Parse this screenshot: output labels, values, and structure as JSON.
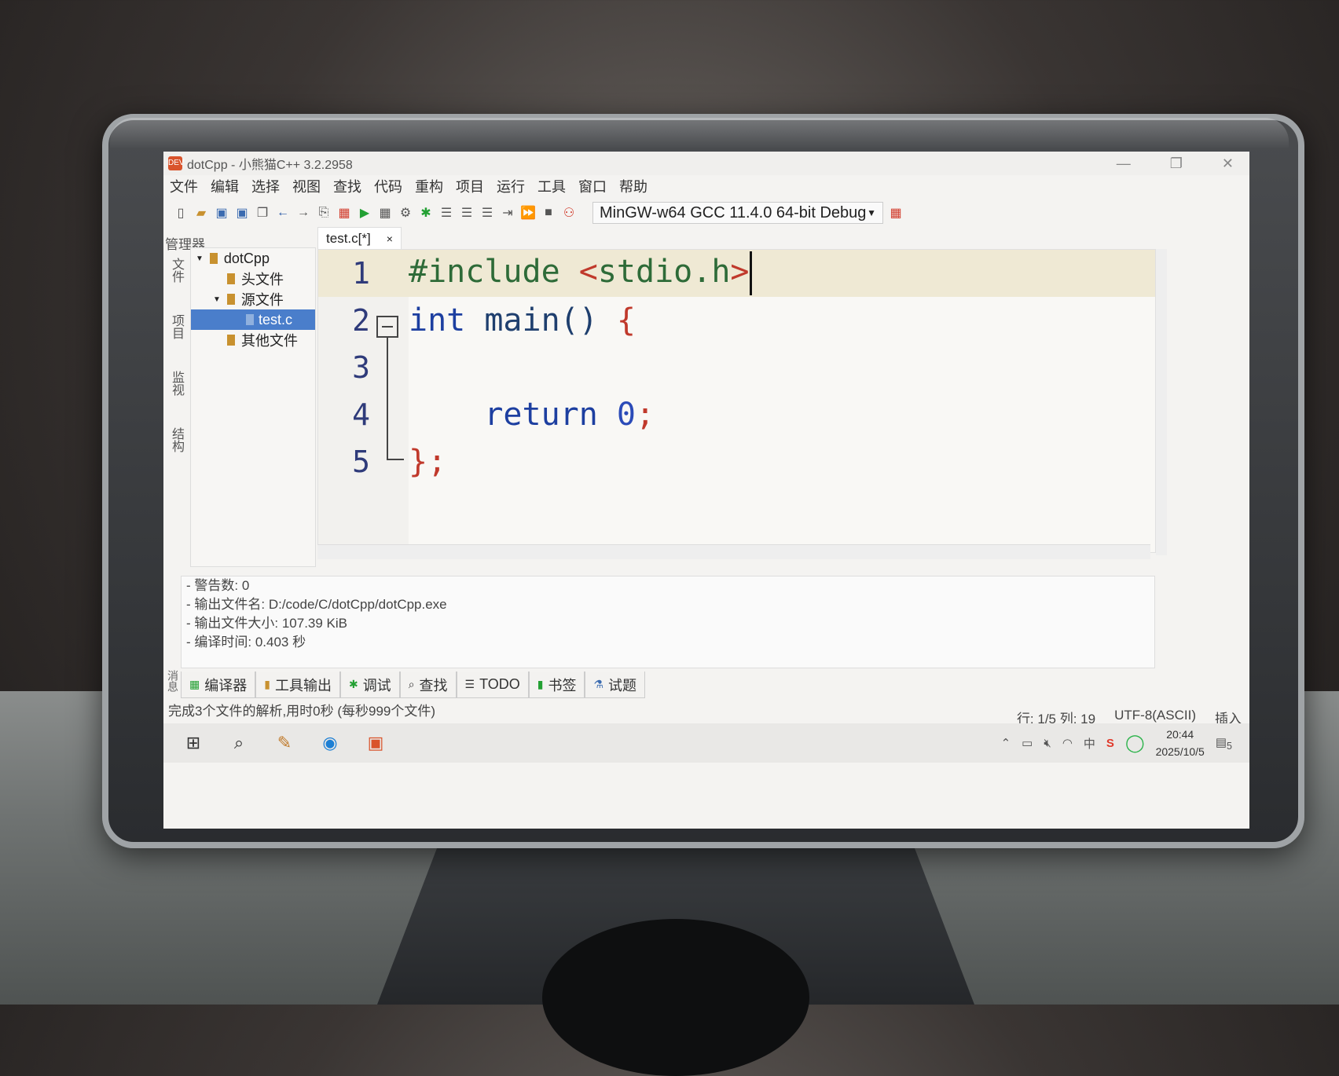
{
  "window": {
    "title": "dotCpp - 小熊猫C++ 3.2.2958",
    "app_icon_text": "DEV",
    "controls": [
      "—",
      "❐",
      "✕"
    ]
  },
  "menu": [
    "文件",
    "编辑",
    "选择",
    "视图",
    "查找",
    "代码",
    "重构",
    "项目",
    "运行",
    "工具",
    "窗口",
    "帮助"
  ],
  "toolbar": {
    "compiler": "MinGW-w64 GCC 11.4.0 64-bit Debug"
  },
  "left_panel": {
    "title": "管理器",
    "side_tabs": [
      "文件",
      "项目",
      "监视",
      "结构"
    ],
    "tree": [
      {
        "label": "dotCpp",
        "level": 0,
        "type": "folder",
        "expanded": true
      },
      {
        "label": "头文件",
        "level": 1,
        "type": "folder"
      },
      {
        "label": "源文件",
        "level": 1,
        "type": "folder",
        "expanded": true
      },
      {
        "label": "test.c",
        "level": 2,
        "type": "file",
        "selected": true
      },
      {
        "label": "其他文件",
        "level": 1,
        "type": "folder"
      }
    ]
  },
  "editor": {
    "tab_label": "test.c[*]",
    "tab_close": "×",
    "lines": [
      {
        "n": "1",
        "parts": [
          [
            "pp",
            "#include "
          ],
          [
            "br",
            "<"
          ],
          [
            "pp",
            "stdio.h"
          ],
          [
            "br",
            ">"
          ]
        ]
      },
      {
        "n": "2",
        "parts": [
          [
            "kw",
            "int"
          ],
          [
            "fn",
            " main() "
          ],
          [
            "br",
            "{"
          ]
        ]
      },
      {
        "n": "3",
        "parts": []
      },
      {
        "n": "4",
        "parts": [
          [
            "fn",
            "    "
          ],
          [
            "kw",
            "return "
          ],
          [
            "num",
            "0"
          ],
          [
            "br",
            ";"
          ]
        ]
      },
      {
        "n": "5",
        "parts": [
          [
            "br",
            "};"
          ]
        ]
      }
    ]
  },
  "output": {
    "lines": [
      "- 警告数: 0",
      "- 输出文件名: D:/code/C/dotCpp/dotCpp.exe",
      "- 输出文件大小: 107.39 KiB",
      "- 编译时间: 0.403 秒"
    ],
    "side_label": "消息"
  },
  "bottom_tabs": [
    "编译器",
    "工具输出",
    "调试",
    "查找",
    "TODO",
    "书签",
    "试题"
  ],
  "status": {
    "left": "完成3个文件的解析,用时0秒 (每秒999个文件)",
    "position": "行: 1/5 列: 19",
    "encoding": "UTF-8(ASCII)",
    "mode": "插入"
  },
  "taskbar": {
    "time": "20:44",
    "date": "2025/10/5",
    "notification_count": "5",
    "ime": "中"
  }
}
